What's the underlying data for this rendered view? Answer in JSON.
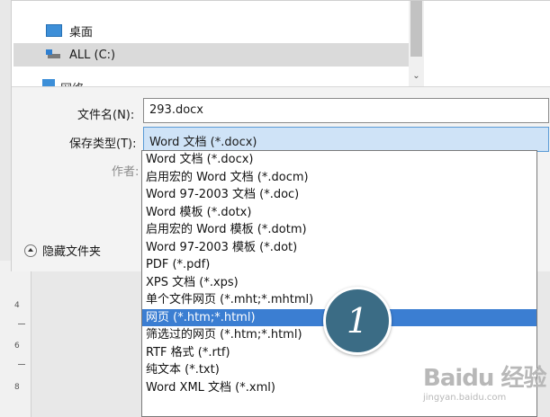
{
  "nav": {
    "items": [
      {
        "label": "桌面",
        "icon": "desktop-icon"
      },
      {
        "label": "ALL (C:)",
        "icon": "drive-icon"
      }
    ],
    "partial_item": "网络"
  },
  "form": {
    "filename_label": "文件名(N):",
    "filename_value": "293.docx",
    "filetype_label": "保存类型(T):",
    "filetype_value": "Word 文档 (*.docx)",
    "author_label": "作者:",
    "hide_folders_label": "隐藏文件夹"
  },
  "dropdown": {
    "options": [
      "Word 文档 (*.docx)",
      "启用宏的 Word 文档 (*.docm)",
      "Word 97-2003 文档 (*.doc)",
      "Word 模板 (*.dotx)",
      "启用宏的 Word 模板 (*.dotm)",
      "Word 97-2003 模板 (*.dot)",
      "PDF (*.pdf)",
      "XPS 文档 (*.xps)",
      "单个文件网页 (*.mht;*.mhtml)",
      "网页 (*.htm;*.html)",
      "筛选过的网页 (*.htm;*.html)",
      "RTF 格式 (*.rtf)",
      "纯文本 (*.txt)",
      "Word XML 文档 (*.xml)"
    ],
    "highlighted_index": 9
  },
  "badge": {
    "number": "1"
  },
  "ruler": {
    "ticks": [
      "4",
      "6",
      "8"
    ]
  },
  "watermark": {
    "main": "Baidu 经验",
    "sub": "jingyan.baidu.com"
  },
  "colors": {
    "highlight": "#3b7ed2",
    "badge": "#3b6c85",
    "combo_bg": "#cfe3f7"
  }
}
